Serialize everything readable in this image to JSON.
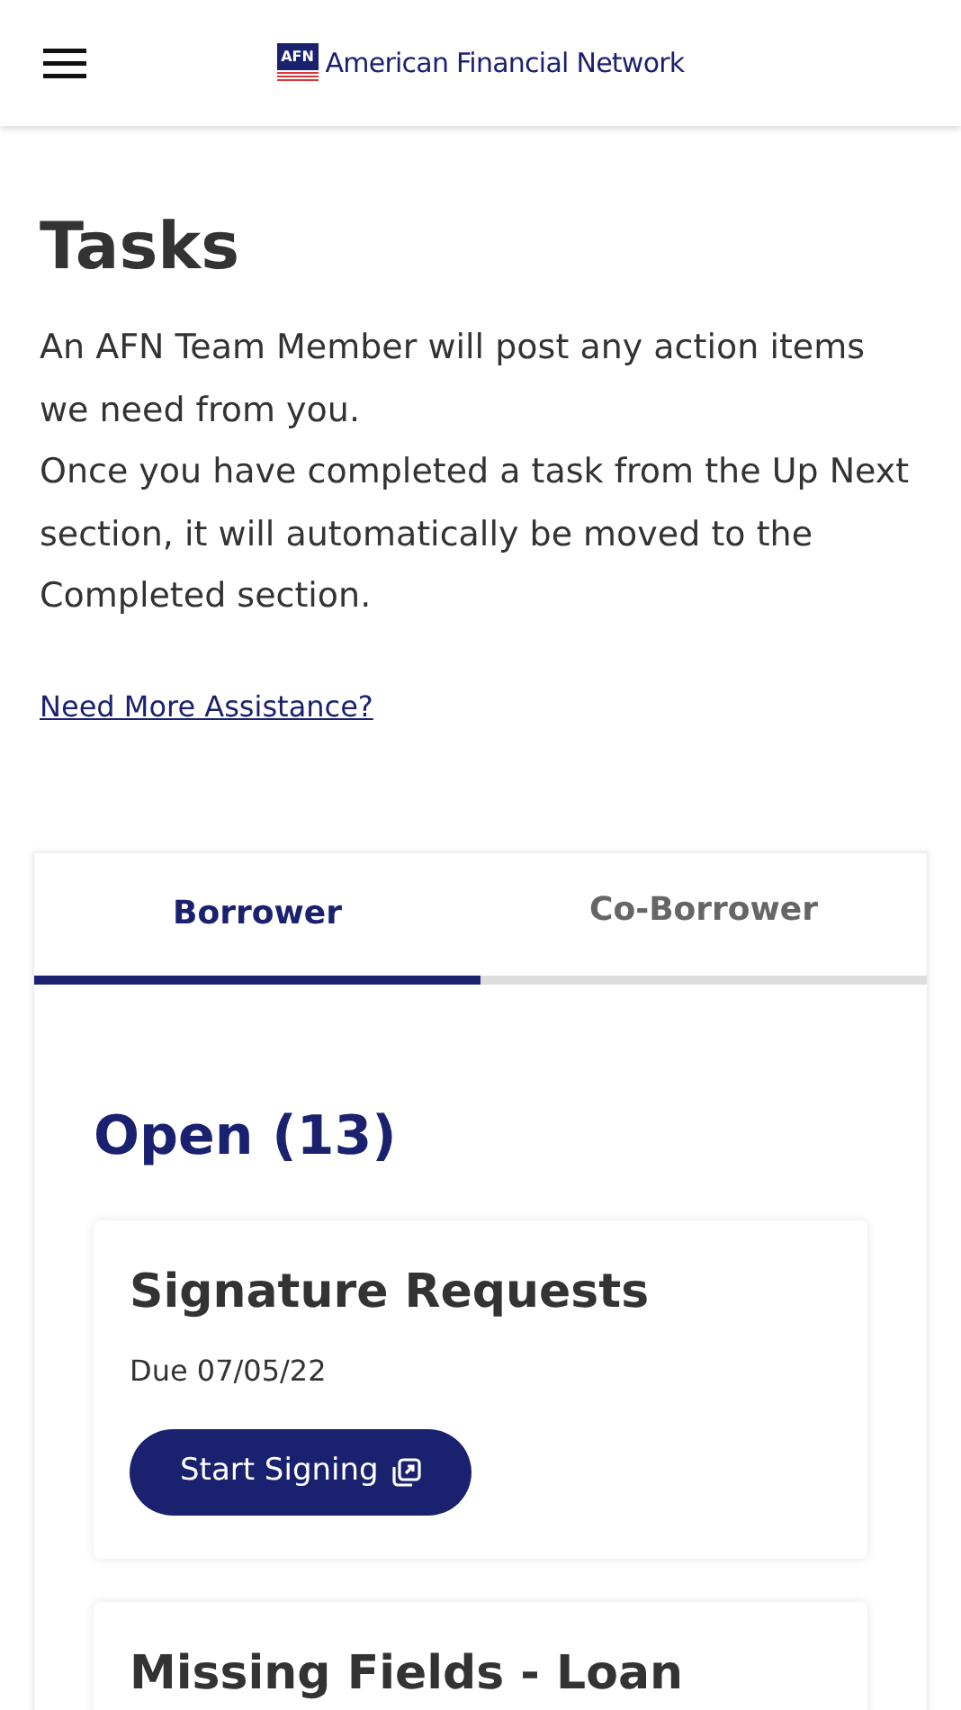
{
  "header": {
    "logo_badge": "AFN",
    "logo_text": "American Financial Network"
  },
  "title": "Tasks",
  "intro": [
    "An AFN Team Member will post any action items we need from you.",
    "Once you have completed a task from the Up Next section, it will automatically be moved to the Completed section."
  ],
  "help_link": "Need More Assistance?",
  "tabs": [
    {
      "label": "Borrower",
      "selected": true
    },
    {
      "label": "Co-Borrower",
      "selected": false
    }
  ],
  "section_title": "Open (13)",
  "tasks": [
    {
      "title": "Signature Requests",
      "due": "Due 07/05/22",
      "action": "Start Signing"
    },
    {
      "title": "Missing Fields - Loan"
    }
  ]
}
